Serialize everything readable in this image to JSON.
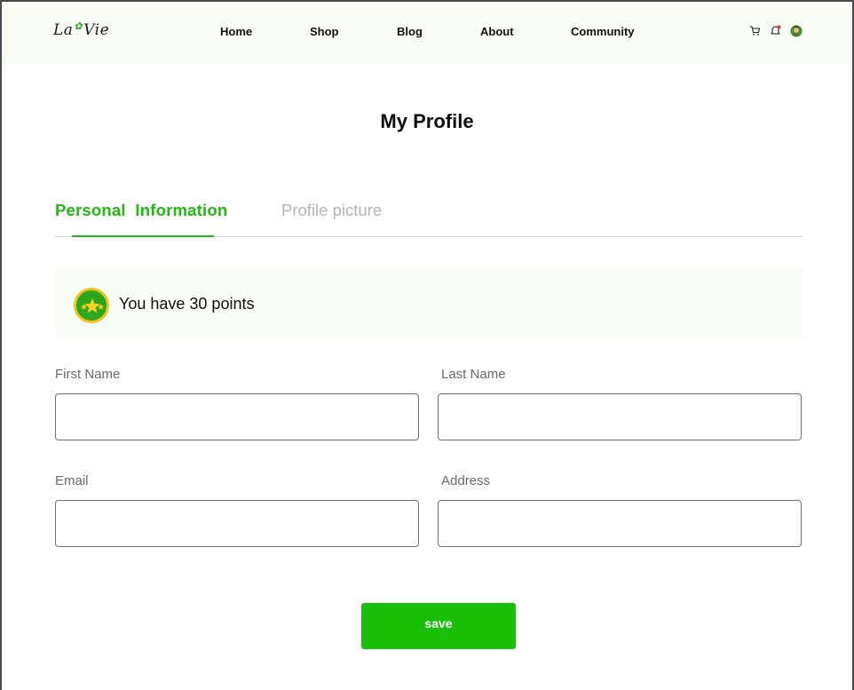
{
  "header": {
    "logo": {
      "part1": "La",
      "part2": "Vie"
    },
    "nav": [
      {
        "label": "Home"
      },
      {
        "label": "Shop"
      },
      {
        "label": "Blog"
      },
      {
        "label": "About"
      },
      {
        "label": "Community"
      }
    ],
    "icons": [
      "cart-icon",
      "notification-bell-icon",
      "user-avatar"
    ]
  },
  "main": {
    "title": "My Profile",
    "tabs": [
      {
        "label": "Personal  Information",
        "active": true
      },
      {
        "label": "Profile picture",
        "active": false
      }
    ],
    "points": {
      "text": "You have 30 points",
      "icon": "stars-badge-icon"
    },
    "form": {
      "first_name": {
        "label": "First Name",
        "value": "",
        "placeholder": ""
      },
      "last_name": {
        "label": "Last Name",
        "value": "",
        "placeholder": ""
      },
      "email": {
        "label": "Email",
        "value": "",
        "placeholder": ""
      },
      "address": {
        "label": "Address",
        "value": "",
        "placeholder": ""
      }
    },
    "save_label": "save"
  },
  "colors": {
    "accent": "#1fbb10",
    "header_bg": "#f7fdf4",
    "button": "#1abf0a",
    "badge_ring": "#f0c419"
  }
}
